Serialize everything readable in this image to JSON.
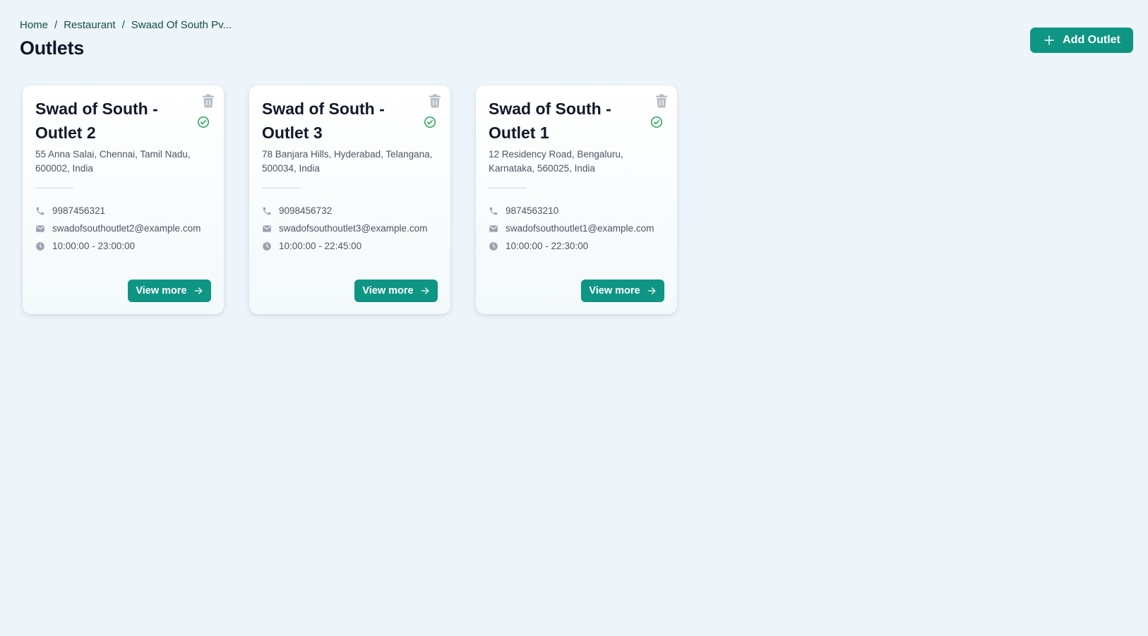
{
  "breadcrumb": {
    "items": [
      "Home",
      "Restaurant",
      "Swaad Of South Pv..."
    ],
    "separator": "/"
  },
  "page": {
    "title": "Outlets"
  },
  "actions": {
    "add_label": "Add Outlet",
    "add_icon": "plus-icon"
  },
  "colors": {
    "accent": "#0f9584",
    "background": "#edf5fb",
    "status_ok": "#16a34a"
  },
  "outlets": [
    {
      "name": "Swad of South - Outlet 2",
      "address": "55 Anna Salai, Chennai, Tamil Nadu, 600002, India",
      "phone": "9987456321",
      "email": "swadofsouthoutlet2@example.com",
      "hours": "10:00:00 - 23:00:00",
      "status_icon": "check-circle-icon",
      "view_label": "View more"
    },
    {
      "name": "Swad of South - Outlet 3",
      "address": "78 Banjara Hills, Hyderabad, Telangana, 500034, India",
      "phone": "9098456732",
      "email": "swadofsouthoutlet3@example.com",
      "hours": "10:00:00 - 22:45:00",
      "status_icon": "check-circle-icon",
      "view_label": "View more"
    },
    {
      "name": "Swad of South - Outlet 1",
      "address": "12 Residency Road, Bengaluru, Karnataka, 560025, India",
      "phone": "9874563210",
      "email": "swadofsouthoutlet1@example.com",
      "hours": "10:00:00 - 22:30:00",
      "status_icon": "check-circle-icon",
      "view_label": "View more"
    }
  ]
}
